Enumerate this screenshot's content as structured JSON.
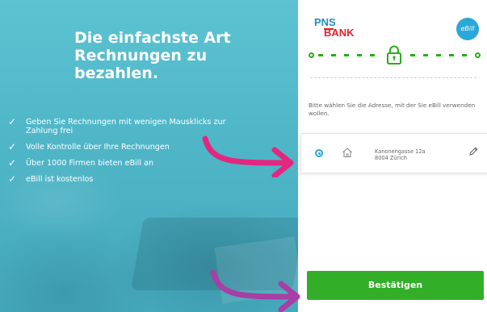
{
  "hero": {
    "headline_line1": "Die einfachste Art",
    "headline_line2": "Rechnungen zu",
    "headline_line3": "bezahlen.",
    "check_glyph": "✓",
    "features": [
      "Geben Sie Rechnungen mit wenigen Mausklicks zur Zahlung frei",
      "Volle Kontrolle über Ihre Rechnungen",
      "Über 1000 Firmen bieten eBill an",
      "eBill ist kostenlos"
    ]
  },
  "logo": {
    "line1": "PNS",
    "line2": "BANK"
  },
  "badge": {
    "label": "eBill"
  },
  "progress": {
    "icon": "lock-icon",
    "state": "locked"
  },
  "address_selection": {
    "prompt": "Bitte wählen Sie die Adresse, mit der Sie eBill verwenden wollen.",
    "addresses": [
      {
        "street": "Kanonengasse 12a",
        "city": "8004 Zürich",
        "selected": true
      }
    ]
  },
  "confirm": {
    "label": "Bestätigen"
  },
  "colors": {
    "accent_green": "#32ae29",
    "brand_blue": "#1e8fb8",
    "brand_red": "#e0242b",
    "teal_panel": "#4fb6c8",
    "arrow_pink": "#e4267f",
    "arrow_purple": "#a83ea6"
  }
}
